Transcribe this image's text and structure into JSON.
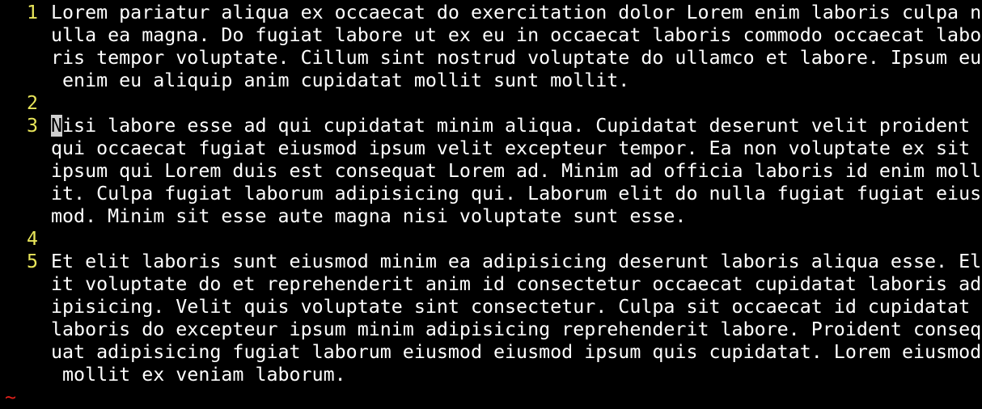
{
  "editor": {
    "colors": {
      "background": "#000000",
      "text": "#ffffff",
      "line_number": "#e8e55a",
      "tilde": "#e0201a",
      "cursor": "#cfcfcf"
    },
    "rows": [
      {
        "num": "1",
        "text": "Lorem pariatur aliqua ex occaecat do exercitation dolor Lorem enim laboris culpa n"
      },
      {
        "num": "",
        "text": "ulla ea magna. Do fugiat labore ut ex eu in occaecat laboris commodo occaecat labo"
      },
      {
        "num": "",
        "text": "ris tempor voluptate. Cillum sint nostrud voluptate do ullamco et labore. Ipsum eu"
      },
      {
        "num": "",
        "text": " enim eu aliquip anim cupidatat mollit sunt mollit."
      },
      {
        "num": "2",
        "text": ""
      },
      {
        "num": "3",
        "text": "isi labore esse ad qui cupidatat minim aliqua. Cupidatat deserunt velit proident",
        "cursor_char": "N"
      },
      {
        "num": "",
        "text": "qui occaecat fugiat eiusmod ipsum velit excepteur tempor. Ea non voluptate ex sit"
      },
      {
        "num": "",
        "text": "ipsum qui Lorem duis est consequat Lorem ad. Minim ad officia laboris id enim moll"
      },
      {
        "num": "",
        "text": "it. Culpa fugiat laborum adipisicing qui. Laborum elit do nulla fugiat fugiat eius"
      },
      {
        "num": "",
        "text": "mod. Minim sit esse aute magna nisi voluptate sunt esse."
      },
      {
        "num": "4",
        "text": ""
      },
      {
        "num": "5",
        "text": "Et elit laboris sunt eiusmod minim ea adipisicing deserunt laboris aliqua esse. El"
      },
      {
        "num": "",
        "text": "it voluptate do et reprehenderit anim id consectetur occaecat cupidatat laboris ad"
      },
      {
        "num": "",
        "text": "ipisicing. Velit quis voluptate sint consectetur. Culpa sit occaecat id cupidatat"
      },
      {
        "num": "",
        "text": "laboris do excepteur ipsum minim adipisicing reprehenderit labore. Proident conseq"
      },
      {
        "num": "",
        "text": "uat adipisicing fugiat laborum eiusmod eiusmod ipsum quis cupidatat. Lorem eiusmod"
      },
      {
        "num": "",
        "text": " mollit ex veniam laborum."
      }
    ],
    "tilde": "~"
  }
}
